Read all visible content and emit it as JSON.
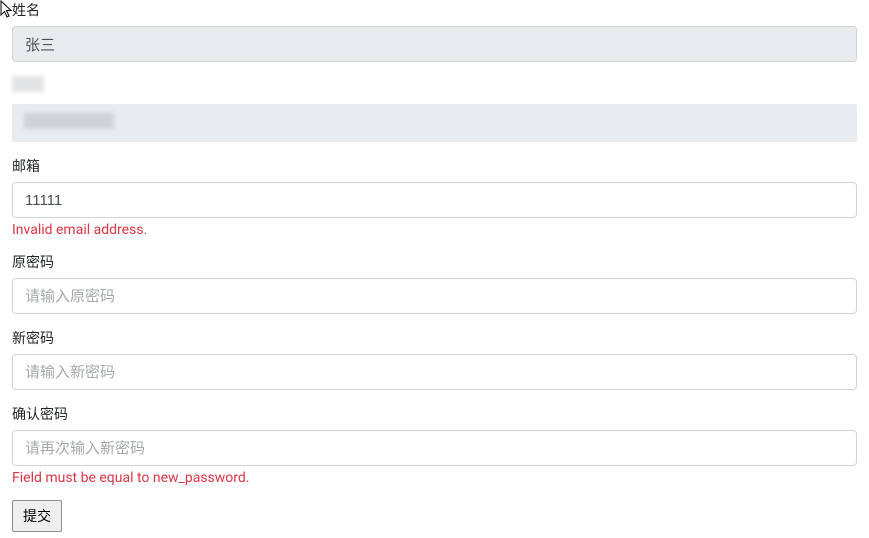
{
  "form": {
    "name": {
      "label": "姓名",
      "value": "张三"
    },
    "email": {
      "label": "邮箱",
      "value": "11111",
      "error": "Invalid email address."
    },
    "old_password": {
      "label": "原密码",
      "placeholder": "请输入原密码"
    },
    "new_password": {
      "label": "新密码",
      "placeholder": "请输入新密码"
    },
    "confirm_password": {
      "label": "确认密码",
      "placeholder": "请再次输入新密码",
      "error": "Field must be equal to new_password."
    },
    "submit_label": "提交"
  }
}
